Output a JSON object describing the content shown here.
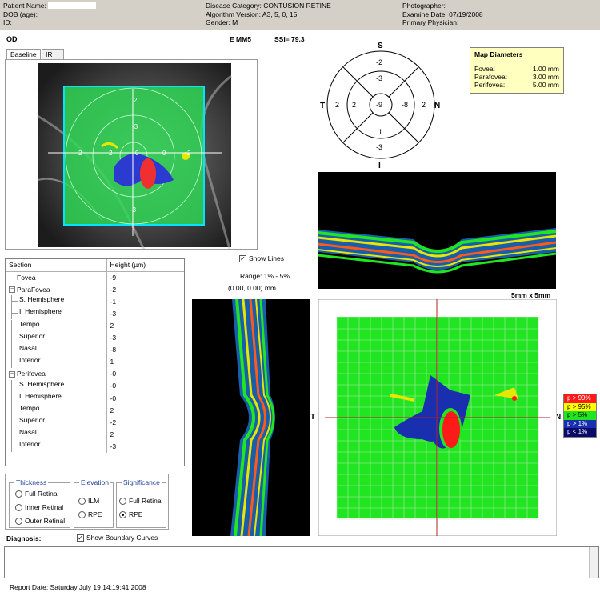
{
  "header": {
    "patient_name_label": "Patient Name:",
    "dob_label": "DOB (age):",
    "id_label": "ID:",
    "disease": "Disease Category: CONTUSION RETINE",
    "algorithm": "Algorithm Version: A3, 5, 0, 15",
    "gender": "Gender: M",
    "photographer": "Photographer:",
    "exam_date": "Examine Date: 07/19/2008",
    "physician": "Primary Physician:"
  },
  "scan": {
    "eye": "OD",
    "mode": "E MM5",
    "ssi": "SSI= 79.3"
  },
  "tabs": [
    "Baseline",
    "IR"
  ],
  "fundus_labels": {
    "top": "2",
    "mid": "-3",
    "left": "2",
    "right": "2",
    "center": "0",
    "right_center": "0",
    "bottom_mid": "1",
    "bottom": "-3",
    "left_center": "2"
  },
  "sector_map": {
    "S": "S",
    "T": "T",
    "N": "N",
    "I": "I",
    "outer_top": "-2",
    "inner_top": "-3",
    "outer_left": "2",
    "inner_left": "2",
    "center": "-9",
    "inner_right": "-8",
    "outer_right": "2",
    "inner_bottom": "1",
    "outer_bottom": "-3"
  },
  "map_diameters": {
    "title": "Map Diameters",
    "rows": [
      {
        "label": "Fovea:",
        "value": "1.00 mm"
      },
      {
        "label": "Parafovea:",
        "value": "3.00 mm"
      },
      {
        "label": "Perifovea:",
        "value": "5.00 mm"
      }
    ]
  },
  "table": {
    "col_section": "Section",
    "col_height": "Height (µm)",
    "rows": [
      {
        "label": "Fovea",
        "value": "-9",
        "indent": 1
      },
      {
        "label": "ParaFovea",
        "value": "-2",
        "indent": 0,
        "expander": "−"
      },
      {
        "label": "S. Hemisphere",
        "value": "-1",
        "indent": 2
      },
      {
        "label": "I. Hemisphere",
        "value": "-3",
        "indent": 2
      },
      {
        "label": "Tempo",
        "value": "2",
        "indent": 2
      },
      {
        "label": "Superior",
        "value": "-3",
        "indent": 2
      },
      {
        "label": "Nasal",
        "value": "-8",
        "indent": 2
      },
      {
        "label": "Inferior",
        "value": "1",
        "indent": 2
      },
      {
        "label": "Perifovea",
        "value": "-0",
        "indent": 0,
        "expander": "−"
      },
      {
        "label": "S. Hemisphere",
        "value": "-0",
        "indent": 2
      },
      {
        "label": "I. Hemisphere",
        "value": "-0",
        "indent": 2
      },
      {
        "label": "Tempo",
        "value": "2",
        "indent": 2
      },
      {
        "label": "Superior",
        "value": "-2",
        "indent": 2
      },
      {
        "label": "Nasal",
        "value": "2",
        "indent": 2
      },
      {
        "label": "Inferior",
        "value": "-3",
        "indent": 2
      }
    ]
  },
  "controls": {
    "show_lines": "Show Lines",
    "range": "Range: 1% - 5%",
    "coords": "(0.00, 0.00) mm",
    "size": "5mm x 5mm",
    "show_boundary": "Show Boundary Curves",
    "check_mark": "✓"
  },
  "thickness": {
    "title": "Thickness",
    "options": [
      "Full Retinal",
      "Inner Retinal",
      "Outer Retinal"
    ]
  },
  "elevation": {
    "title": "Elevation",
    "options": [
      "ILM",
      "RPE"
    ]
  },
  "significance": {
    "title": "Significance",
    "options": [
      "Full Retinal",
      "RPE"
    ],
    "selected": 1
  },
  "significance_map": {
    "T": "T",
    "N": "N"
  },
  "legend": [
    {
      "label": "p > 99%",
      "color": "#ff1a1a",
      "text": "#ffffff"
    },
    {
      "label": "p > 95%",
      "color": "#ffff00",
      "text": "#000000"
    },
    {
      "label": "p > 5%",
      "color": "#22e522",
      "text": "#000000"
    },
    {
      "label": "p > 1%",
      "color": "#1a2fb0",
      "text": "#ffffff"
    },
    {
      "label": "p < 1%",
      "color": "#0a0a6a",
      "text": "#ffffff"
    }
  ],
  "diagnosis_label": "Diagnosis:",
  "report_date": "Report Date: Saturday July 19 14:19:41 2008"
}
